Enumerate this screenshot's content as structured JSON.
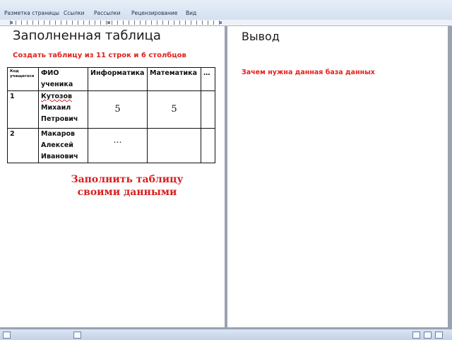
{
  "ribbon": {
    "tabs": [
      "Разметка страницы",
      "Ссылки",
      "Рассылки",
      "Рецензирование",
      "Вид"
    ]
  },
  "left_page": {
    "title": "Заполненная таблица",
    "subtitle": "Создать таблицу из 11 строк и 6 столбцов",
    "table": {
      "headers": [
        "Код учащегося",
        "ФИО ученика",
        "Информатика",
        "Математика",
        "…"
      ],
      "rows": [
        {
          "code": "1",
          "name_lines": [
            "Кутозов",
            "Михаил",
            "Петрович"
          ],
          "informatics": "5",
          "math": "5",
          "extra": ""
        },
        {
          "code": "2",
          "name_lines": [
            "Макаров",
            "Алексей",
            "Иванович"
          ],
          "informatics": "…",
          "math": "",
          "extra": ""
        }
      ]
    },
    "note_lines": [
      "Заполнить таблицу",
      "своими данными"
    ]
  },
  "right_page": {
    "title": "Вывод",
    "question": "Зачем нужна данная база данных"
  },
  "colors": {
    "accent_red": "#e0221e",
    "page_background": "#ffffff",
    "workspace_gray": "#9aa3ae",
    "ribbon_blue": "#d4e0f0"
  }
}
